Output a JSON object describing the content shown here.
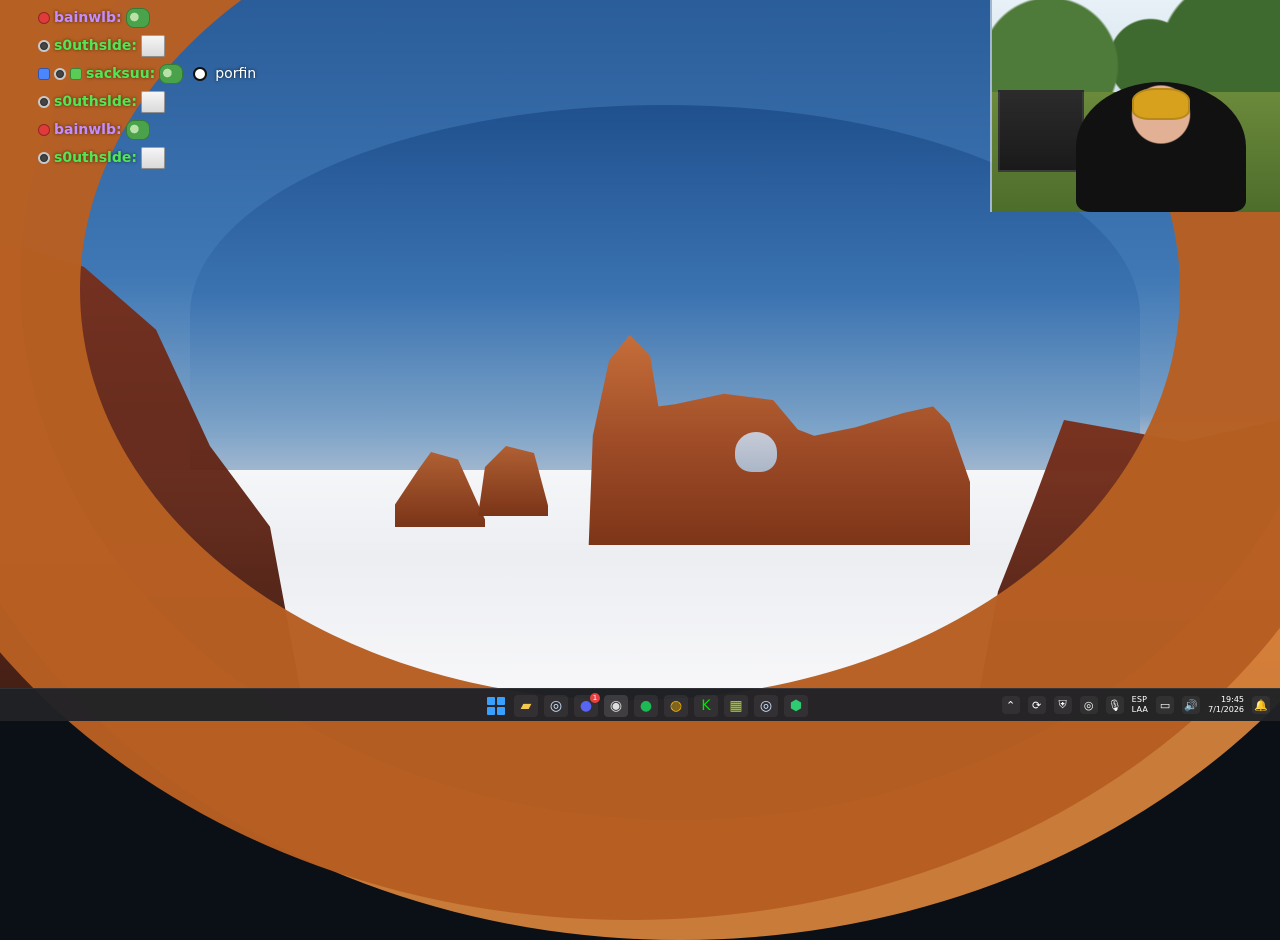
{
  "chat": {
    "lines": [
      {
        "username": "bainwlb:",
        "username_color": "#c58cff",
        "badges": [
          "red-dot-badge"
        ],
        "emote": "pepe-emote"
      },
      {
        "username": "s0uthslde:",
        "username_color": "#53e653",
        "badges": [
          "moderator-badge"
        ],
        "emote": "wide-face-emote"
      },
      {
        "username": "sacksuu:",
        "username_color": "#53e653",
        "badges": [
          "check-badge",
          "moderator-badge",
          "crown-badge"
        ],
        "emote": "pepe-emote",
        "message": "porfin"
      },
      {
        "username": "s0uthslde:",
        "username_color": "#53e653",
        "badges": [
          "moderator-badge"
        ],
        "emote": "wide-face-emote"
      },
      {
        "username": "bainwlb:",
        "username_color": "#c58cff",
        "badges": [
          "red-dot-badge"
        ],
        "emote": "pepe-emote"
      },
      {
        "username": "s0uthslde:",
        "username_color": "#53e653",
        "badges": [
          "moderator-badge"
        ],
        "emote": "wide-face-emote"
      }
    ]
  },
  "taskbar": {
    "pinned_apps": [
      {
        "name": "windows-start",
        "icon": "windows-logo"
      },
      {
        "name": "file-explorer",
        "icon": "folder-icon"
      },
      {
        "name": "steam",
        "icon": "steam-icon"
      },
      {
        "name": "discord",
        "icon": "discord-icon",
        "badge": "1"
      },
      {
        "name": "obs",
        "icon": "obs-icon"
      },
      {
        "name": "spotify",
        "icon": "spotify-icon"
      },
      {
        "name": "chrome",
        "icon": "chrome-icon"
      },
      {
        "name": "kick",
        "icon": "kick-icon"
      },
      {
        "name": "app-grid",
        "icon": "grid-app-icon"
      },
      {
        "name": "steam-2",
        "icon": "steam-icon"
      },
      {
        "name": "green-app",
        "icon": "green-app-icon"
      }
    ],
    "tray": {
      "language_top": "ESP",
      "language_bottom": "LAA",
      "time": "19:45",
      "date": "7/1/2026"
    }
  }
}
